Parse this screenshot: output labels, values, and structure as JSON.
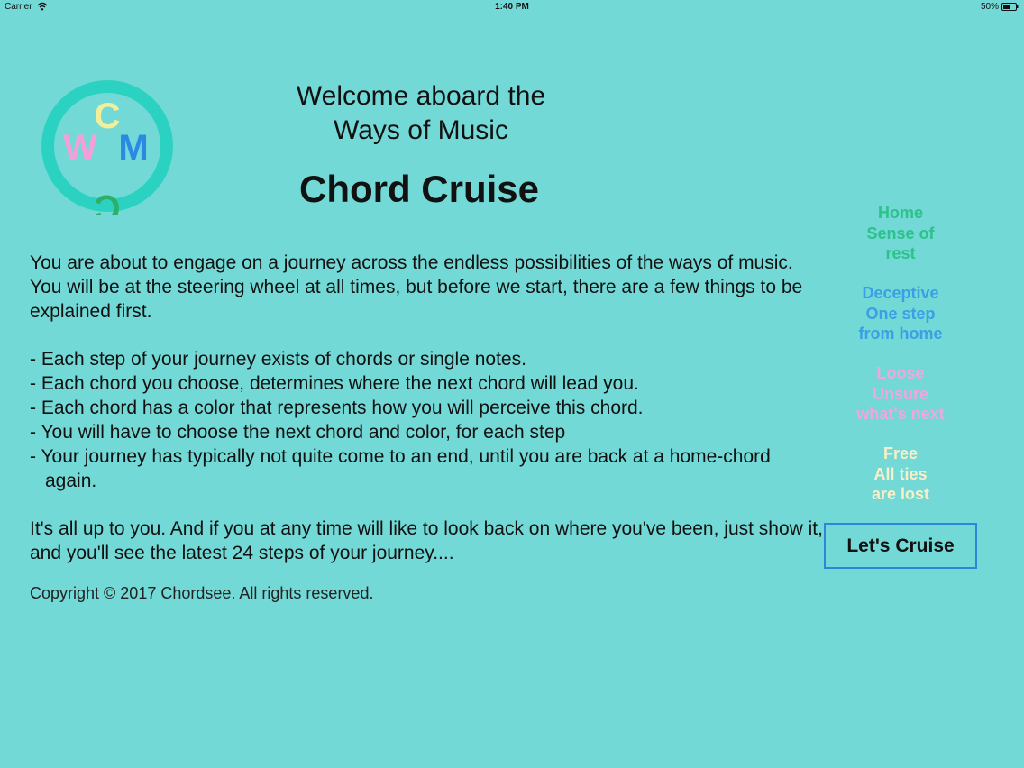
{
  "colors": {
    "background": "#72d9d6",
    "home": "#2cc289",
    "deceptive": "#3a9fe4",
    "loose": "#f1a6e0",
    "free": "#f7efc9",
    "button_border": "#2f86d8",
    "logo_ring": "#2bd2c2",
    "logo_c_top": "#f3ef99",
    "logo_w": "#f49fd8",
    "logo_m": "#2a8ae3",
    "logo_c_bottom": "#2db067"
  },
  "status_bar": {
    "carrier": "Carrier",
    "wifi_icon": "wifi-icon",
    "time": "1:40 PM",
    "battery": "50%",
    "battery_icon": "battery-icon"
  },
  "logo": {
    "letters": {
      "top": "C",
      "left": "W",
      "right": "M",
      "bottom": "C"
    }
  },
  "header": {
    "welcome_line1": "Welcome aboard the",
    "welcome_line2": "Ways of Music",
    "title": "Chord Cruise"
  },
  "intro": {
    "paragraph": "You are about to engage on a journey across the endless possibilities of the ways of music. You will be at the steering wheel at all times, but before we start, there are a few things to be explained first.",
    "rules": [
      "- Each step of your journey exists of chords or single notes.",
      "- Each chord you choose, determines where the next chord will lead you.",
      "- Each chord has a color that represents how you will perceive this chord.",
      "- You will have to choose the next chord and color, for each step",
      "- Your journey has typically not quite come to an end, until you are back at a home-chord again."
    ],
    "closing": "It's all up to you. And if you at any time will like to look back on where you've been, just show it, and you'll see the latest 24 steps of your journey....",
    "copyright": "Copyright © 2017 Chordsee. All rights reserved."
  },
  "legend": [
    {
      "title": "Home",
      "line1": "Sense of",
      "line2": "rest",
      "color": "#2cc289"
    },
    {
      "title": "Deceptive",
      "line1": "One step",
      "line2": "from home",
      "color": "#3a9fe4"
    },
    {
      "title": "Loose",
      "line1": "Unsure",
      "line2": "what's next",
      "color": "#f1a6e0"
    },
    {
      "title": "Free",
      "line1": "All ties",
      "line2": "are lost",
      "color": "#f7efc9"
    }
  ],
  "actions": {
    "cruise_label": "Let's Cruise"
  }
}
